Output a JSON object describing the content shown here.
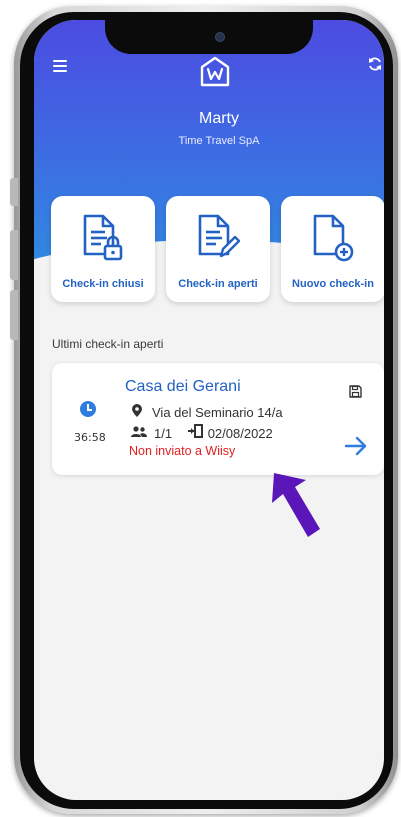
{
  "header": {
    "user_name": "Marty",
    "company": "Time Travel SpA"
  },
  "actions": [
    {
      "label": "Check-in chiusi",
      "icon": "lock-document-icon"
    },
    {
      "label": "Check-in aperti",
      "icon": "edit-document-icon"
    },
    {
      "label": "Nuovo check-in",
      "icon": "add-document-icon"
    }
  ],
  "section_title": "Ultimi check-in aperti",
  "checkin": {
    "property": "Casa dei Gerani",
    "address": "Via del Seminario 14/a",
    "guests": "1/1",
    "date": "02/08/2022",
    "status": "Non inviato a Wiisy",
    "elapsed": "36:58"
  },
  "colors": {
    "brand_blue": "#2362c2",
    "header_gradient_top": "#4c4ce0",
    "header_gradient_bottom": "#2f8de0",
    "status_red": "#e02020",
    "cursor_purple": "#5a16b8"
  }
}
